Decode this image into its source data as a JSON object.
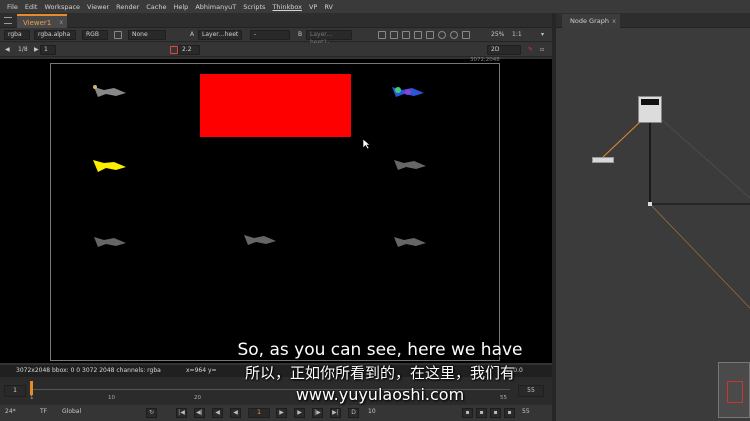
{
  "menu": [
    "File",
    "Edit",
    "Workspace",
    "Viewer",
    "Render",
    "Cache",
    "Help",
    "AbhimanyuT",
    "Scripts",
    "Thinkbox",
    "VP",
    "RV"
  ],
  "viewer_tab": {
    "label": "Viewer1",
    "close": "x"
  },
  "toolbar1": {
    "channels": "rgba",
    "alpha": "rgba.alpha",
    "colorspace": "RGB",
    "lut": "None",
    "input_a_label": "A",
    "input_a": "Layer…heet",
    "sep_value": "-",
    "input_b_label": "B",
    "input_b": "Layer…heet1-",
    "zoom": "25%",
    "ratio": "1:1"
  },
  "toolbar2": {
    "downrez": "1/8",
    "frame": "1",
    "gain_value": "2.2",
    "view_mode": "2D"
  },
  "format_label": "3072,2048",
  "info": {
    "left": "3072x2048  bbox: 0 0 3072 2048 channels: rgba",
    "coords": "x=964 y=",
    "right": "L: 0.0"
  },
  "timeline": {
    "start": "1",
    "end": "55",
    "ticks": [
      "1",
      "10",
      "20",
      "55"
    ]
  },
  "bottom": {
    "fps": "24*",
    "tf": "TF",
    "mode": "Global",
    "frame": "1",
    "step": "10",
    "end_frame": "55"
  },
  "node_graph": {
    "tab": "Node Graph",
    "close": "x"
  },
  "subtitles": {
    "en": "So, as you can see, here we have",
    "zh": "所以，正如你所看到的，在这里，我们有",
    "site": "www.yuyulaoshi.com"
  },
  "colors": {
    "accent": "#e58b2a",
    "red_shape": "#ff0000",
    "yellow_sprite": "#ffee00"
  }
}
